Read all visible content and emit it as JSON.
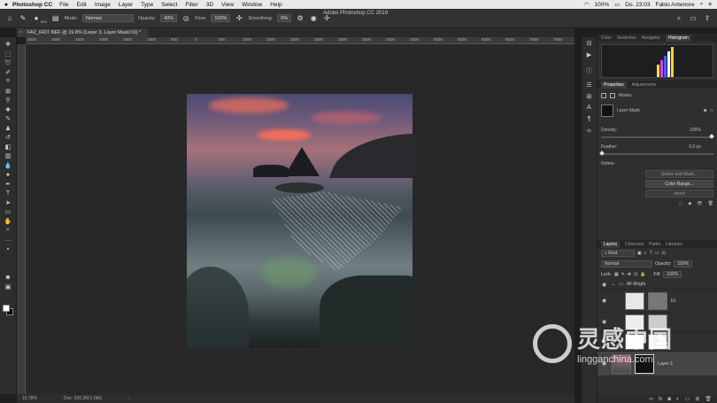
{
  "menubar": {
    "apple": "",
    "app_name": "Photoshop CC",
    "items": [
      "File",
      "Edit",
      "Image",
      "Layer",
      "Type",
      "Select",
      "Filter",
      "3D",
      "View",
      "Window",
      "Help"
    ],
    "battery": "100%",
    "clock": "Do. 23:03",
    "user": "Fabio Antenore"
  },
  "window_title": "Adobe Photoshop CC 2019",
  "options": {
    "mode_label": "Mode:",
    "mode_value": "Normal",
    "opacity_label": "Opacity:",
    "opacity_value": "40%",
    "flow_label": "Flow:",
    "flow_value": "100%",
    "smoothing_label": "Smoothing:",
    "smoothing_value": "0%",
    "brush_size": "500"
  },
  "document_tab": "FA2_6437.NEF @ 19.8% (Layer 3, Layer Mask/16) *",
  "ruler_labels": [
    "3500",
    "3000",
    "2500",
    "2000",
    "1500",
    "1000",
    "500",
    "0",
    "500",
    "1000",
    "1500",
    "2000",
    "2500",
    "3000",
    "3500",
    "4000",
    "4500",
    "5000",
    "5500",
    "6000",
    "6500",
    "7000",
    "7500"
  ],
  "status": {
    "zoom": "19.78%",
    "doc": "Doc: 206.2M/1.06G"
  },
  "panels": {
    "top_tabs": [
      "Color",
      "Swatches",
      "Navigator",
      "Histogram"
    ],
    "active_top_tab": "Histogram",
    "props_tabs": [
      "Properties",
      "Adjustments"
    ],
    "masks_label": "Masks",
    "layer_mask_label": "Layer Mask",
    "density_label": "Density:",
    "density_value": "100%",
    "density_fraction": 1.0,
    "feather_label": "Feather:",
    "feather_value": "0.0 px",
    "feather_fraction": 0.0,
    "refine_label": "Refine:",
    "select_mask_btn": "Select and Mask...",
    "color_range_btn": "Color Range...",
    "invert_btn": "Invert"
  },
  "layers": {
    "tabs": [
      "Layers",
      "Channels",
      "Paths",
      "Libraries"
    ],
    "kind": "Kind",
    "blend": "Normal",
    "opacity_label": "Opacity:",
    "opacity_value": "100%",
    "lock_label": "Lock:",
    "fill_label": "Fill:",
    "fill_value": "100%",
    "items": [
      {
        "name": "AF-Bright"
      },
      {
        "name": "b1"
      },
      {
        "name": ""
      },
      {
        "name": ""
      },
      {
        "name": "Layer 3"
      }
    ]
  },
  "watermark": {
    "cn": "灵感中国",
    "url": "lingganchina.com"
  }
}
